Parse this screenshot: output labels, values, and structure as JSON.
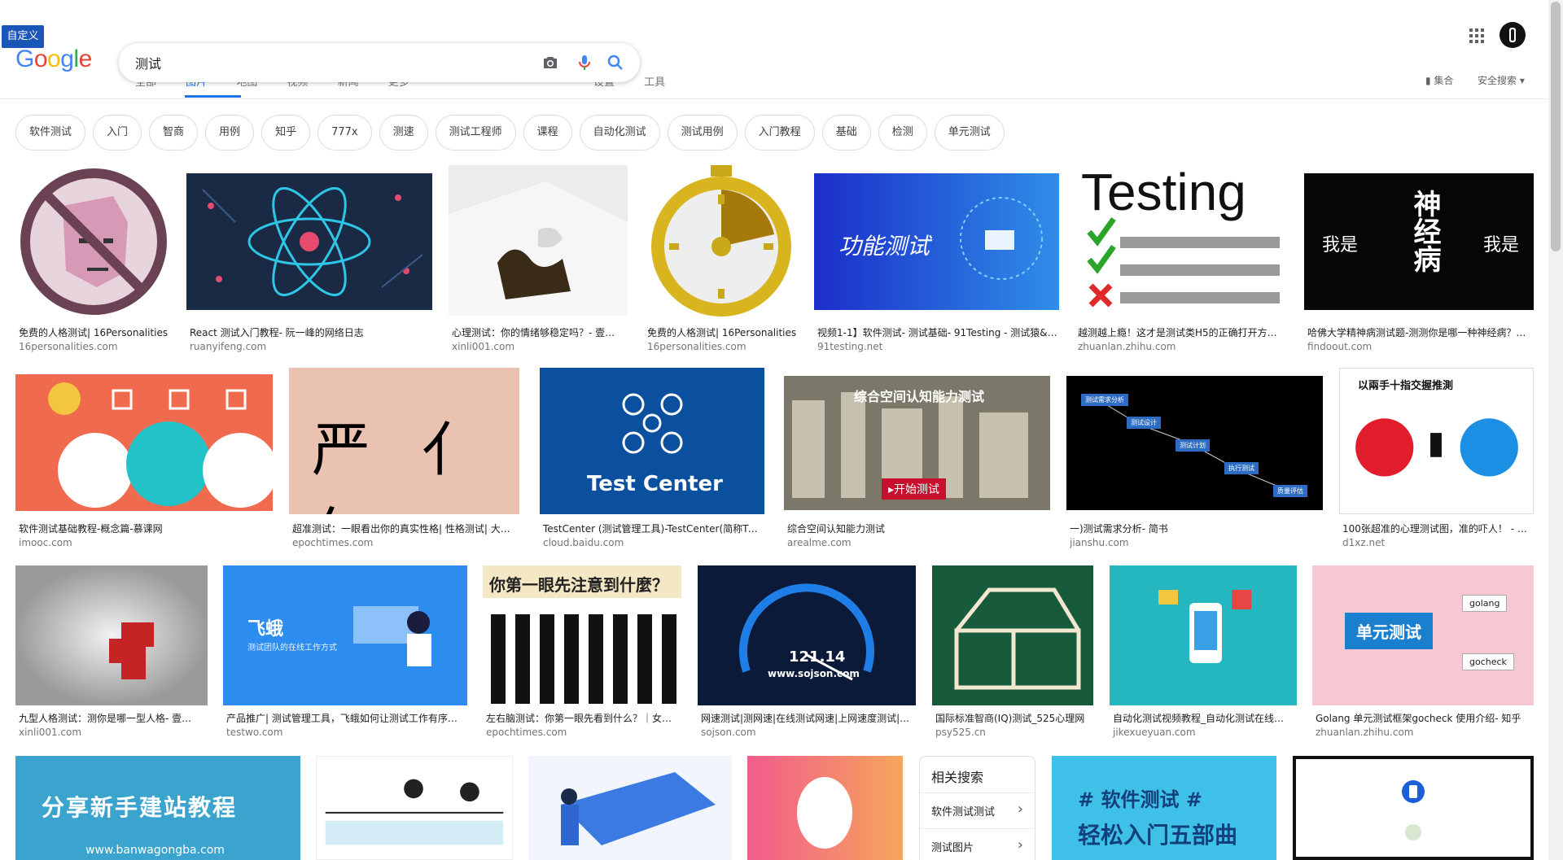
{
  "header": {
    "custom_badge": "自定义",
    "logo": [
      "G",
      "o",
      "o",
      "g",
      "l",
      "e"
    ],
    "search_value": "测试",
    "tabs_peek": [
      "全部",
      "图片",
      "地图",
      "视频",
      "新闻",
      "更多",
      "设置",
      "工具"
    ],
    "collect_label": "集合",
    "safe_search_label": "安全搜索 ▾",
    "colors": {
      "blue": "#4285F4",
      "red": "#EA4335",
      "yellow": "#FBBC05",
      "green": "#34A853",
      "tab_active": "#1a73e8"
    }
  },
  "chips": [
    "软件测试",
    "入门",
    "智商",
    "用例",
    "知乎",
    "777x",
    "测速",
    "测试工程师",
    "课程",
    "自动化测试",
    "测试用例",
    "入门教程",
    "基础",
    "检测",
    "单元测试"
  ],
  "results": [
    {
      "caption": "免费的人格测试| 16Personalities",
      "source": "16personalities.com"
    },
    {
      "caption": "React 测试入门教程- 阮一峰的网络日志",
      "source": "ruanyifeng.com"
    },
    {
      "caption": "心理测试：你的情绪够稳定吗？- 壹…",
      "source": "xinli001.com"
    },
    {
      "caption": "免费的人格测试| 16Personalities",
      "source": "16personalities.com"
    },
    {
      "caption": "视频1-1】软件测试- 测试基础- 91Testing - 测试猿&…",
      "source": "91testing.net"
    },
    {
      "caption": "越测越上瘾！这才是测试类H5的正确打开方…",
      "source": "zhuanlan.zhihu.com"
    },
    {
      "caption": "哈佛大学精神病测试题-测测你是哪一种神经病？…",
      "source": "findoout.com"
    },
    {
      "caption": "软件测试基础教程-概念篇-慕课网",
      "source": "imooc.com"
    },
    {
      "caption": "超准测试：一眼看出你的真实性格| 性格测试| 大…",
      "source": "epochtimes.com"
    },
    {
      "caption": "TestCenter (测试管理工具)-TestCenter(简称TC)…",
      "source": "cloud.baidu.com"
    },
    {
      "caption": "综合空间认知能力测试",
      "source": "arealme.com"
    },
    {
      "caption": "一)测试需求分析- 简书",
      "source": "jianshu.com"
    },
    {
      "caption": "100张超准的心理测试图，准的吓人！ - …",
      "source": "d1xz.net"
    },
    {
      "caption": "九型人格测试：测你是哪一型人格- 壹…",
      "source": "xinli001.com"
    },
    {
      "caption": "产品推广| 测试管理工具，飞蛾如何让测试工作有序…",
      "source": "testwo.com"
    },
    {
      "caption": "左右脑测试：你第一眼先看到什么？｜女…",
      "source": "epochtimes.com"
    },
    {
      "caption": "网速测试|测网速|在线测试网速|上网速度测试|…",
      "source": "sojson.com"
    },
    {
      "caption": "国际标准智商(IQ)测试_525心理网",
      "source": "psy525.cn"
    },
    {
      "caption": "自动化测试视频教程_自动化测试在线…",
      "source": "jikexueyuan.com"
    },
    {
      "caption": "Golang 单元测试框架gocheck 使用介绍- 知乎",
      "source": "zhuanlan.zhihu.com"
    }
  ],
  "image_text": {
    "r1_5": "功能测试",
    "r1_6": "Testing",
    "r1_7_left": "我是",
    "r1_7_mid": "神经病",
    "r1_7_right": "我是",
    "r2_8": "严 亻乍",
    "r2_10_title": "Test Center",
    "r2_11_title": "综合空间认知能力测试",
    "r2_11_btn": "▸开始测试",
    "r2_12_n1": "测试需求分析",
    "r2_12_n2": "测试设计",
    "r2_12_n3": "测试计划",
    "r2_12_n4": "执行测试",
    "r2_12_n5": "质量评估",
    "r2_13_title": "以兩手十指交握推測",
    "r3_15": "飞蛾",
    "r3_15_sub": "测试团队的在线工作方式",
    "r3_16": "你第一眼先注意到什麼？",
    "r3_17_speed": "121.14",
    "r3_17_site": "www.sojson.com",
    "r3_20_main": "单元测试",
    "r3_20_a": "golang",
    "r3_20_b": "gocheck",
    "r4_1": "分享新手建站教程",
    "r4_1_url": "www.banwagongba.com",
    "r4_7a": "# 软件测试 #",
    "r4_7b": "轻松入门五部曲"
  },
  "related": {
    "title": "相关搜索",
    "items": [
      "软件测试测试",
      "测试图片"
    ]
  }
}
